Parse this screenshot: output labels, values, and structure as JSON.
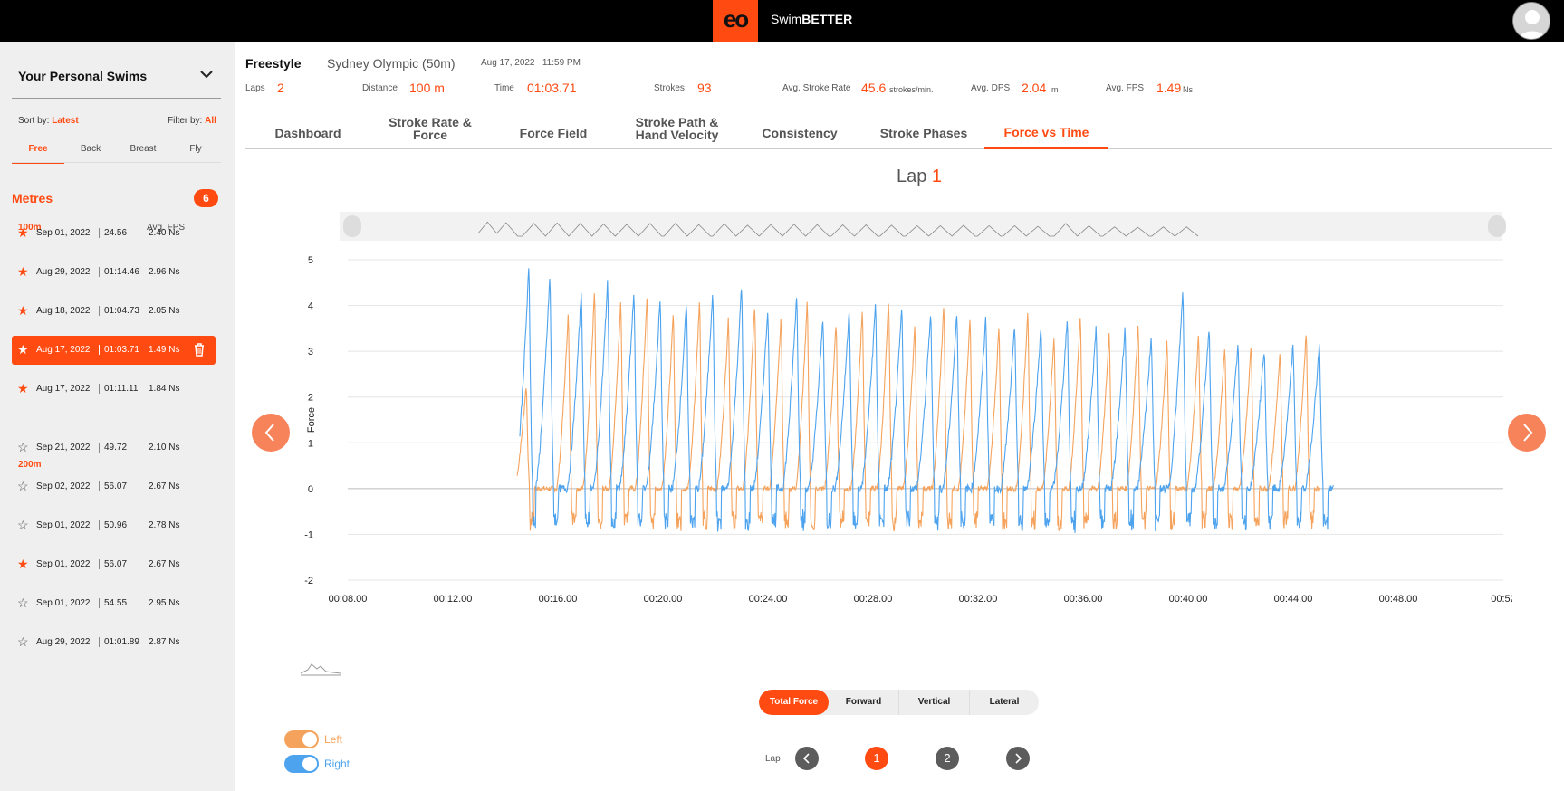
{
  "app": {
    "brand_prefix": "Swim",
    "brand_suffix": "BETTER",
    "logo_text": "eo"
  },
  "sidebar": {
    "title": "Your Personal Swims",
    "sort_label": "Sort by:",
    "sort_value": "Latest",
    "filter_label": "Filter by:",
    "filter_value": "All",
    "stroke_tabs": [
      "Free",
      "Back",
      "Breast",
      "Fly"
    ],
    "active_stroke": "Free",
    "section_title": "Metres",
    "section_count": "6",
    "fps_header": "Avg. FPS",
    "group_100": "100m",
    "group_200": "200m",
    "swims": [
      {
        "date": "Sep 01, 2022",
        "time": "24.56",
        "fps": "2.40 Ns",
        "starred": true
      },
      {
        "date": "Aug 29, 2022",
        "time": "01:14.46",
        "fps": "2.96 Ns",
        "starred": true
      },
      {
        "date": "Aug 18, 2022",
        "time": "01:04.73",
        "fps": "2.05 Ns",
        "starred": true
      },
      {
        "date": "Aug 17, 2022",
        "time": "01:03.71",
        "fps": "1.49 Ns",
        "starred": true,
        "selected": true
      },
      {
        "date": "Aug 17, 2022",
        "time": "01:11.11",
        "fps": "1.84 Ns",
        "starred": true
      },
      {
        "date": "Sep 21, 2022",
        "time": "49.72",
        "fps": "2.10 Ns",
        "starred": false
      },
      {
        "date": "Sep 02, 2022",
        "time": "56.07",
        "fps": "2.67 Ns",
        "starred": false
      },
      {
        "date": "Sep 01, 2022",
        "time": "50.96",
        "fps": "2.78 Ns",
        "starred": false
      },
      {
        "date": "Sep 01, 2022",
        "time": "56.07",
        "fps": "2.67 Ns",
        "starred": true
      },
      {
        "date": "Sep 01, 2022",
        "time": "54.55",
        "fps": "2.95 Ns",
        "starred": false
      },
      {
        "date": "Aug 29, 2022",
        "time": "01:01.89",
        "fps": "2.87 Ns",
        "starred": false
      }
    ]
  },
  "header": {
    "stroke": "Freestyle",
    "pool": "Sydney Olympic (50m)",
    "date": "Aug 17, 2022",
    "clock": "11:59 PM",
    "laps_label": "Laps",
    "laps_value": "2",
    "distance_label": "Distance",
    "distance_value": "100 m",
    "time_label": "Time",
    "time_value": "01:03.71",
    "strokes_label": "Strokes",
    "strokes_value": "93",
    "rate_label": "Avg. Stroke Rate",
    "rate_value": "45.6",
    "rate_unit": "strokes/min.",
    "dps_label": "Avg. DPS",
    "dps_value": "2.04",
    "dps_unit": "m",
    "fps_label": "Avg. FPS",
    "fps_value": "1.49",
    "fps_unit": "Ns"
  },
  "tabs": [
    {
      "line1": "Dashboard",
      "line2": ""
    },
    {
      "line1": "Stroke Rate &",
      "line2": "Force"
    },
    {
      "line1": "Force Field",
      "line2": ""
    },
    {
      "line1": "Stroke Path &",
      "line2": "Hand Velocity"
    },
    {
      "line1": "Consistency",
      "line2": ""
    },
    {
      "line1": "Stroke Phases",
      "line2": ""
    },
    {
      "line1": "Force vs Time",
      "line2": ""
    }
  ],
  "active_tab": "Force vs Time",
  "lap_title": {
    "label": "Lap",
    "value": "1"
  },
  "force_modes": [
    "Total Force",
    "Forward",
    "Vertical",
    "Lateral"
  ],
  "active_force_mode": "Total Force",
  "legend": {
    "left": "Left",
    "right": "Right"
  },
  "lap_pager": {
    "label": "Lap",
    "pages": [
      "1",
      "2"
    ],
    "active": "1"
  },
  "colors": {
    "accent": "#ff4b12",
    "left": "#f5a35c",
    "right": "#4da3ee"
  },
  "chart_data": {
    "type": "line",
    "ylabel": "Force",
    "xlabel": "",
    "ylim": [
      -2,
      5
    ],
    "xlim": [
      "00:08.00",
      "00:52.00"
    ],
    "x_ticks": [
      "00:08.00",
      "00:12.00",
      "00:16.00",
      "00:20.00",
      "00:24.00",
      "00:28.00",
      "00:32.00",
      "00:36.00",
      "00:40.00",
      "00:44.00",
      "00:48.00",
      "00:52"
    ],
    "y_ticks": [
      5,
      4,
      3,
      2,
      1,
      0,
      -1,
      -2
    ],
    "grid": true,
    "series": [
      {
        "name": "Left",
        "color": "#f5a35c",
        "stroke_peaks_t": [
          14.8,
          16.4,
          17.4,
          18.4,
          19.4,
          20.4,
          21.4,
          22.5,
          23.5,
          24.5,
          25.5,
          26.6,
          27.6,
          28.6,
          29.6,
          30.7,
          31.7,
          32.8,
          33.9,
          34.9,
          35.9,
          37.0,
          38.1,
          39.2,
          40.4,
          41.4,
          42.4,
          43.5,
          44.5
        ],
        "stroke_peaks_force": [
          2.3,
          3.9,
          4.4,
          4.2,
          4.3,
          3.9,
          4.2,
          3.8,
          4.1,
          3.8,
          4.2,
          3.7,
          4.0,
          4.2,
          3.6,
          4.1,
          3.8,
          3.6,
          4.0,
          3.4,
          3.9,
          3.5,
          3.7,
          3.3,
          3.4,
          3.2,
          3.2,
          3.0,
          3.5
        ],
        "baseline": 0.0
      },
      {
        "name": "Right",
        "color": "#4da3ee",
        "stroke_peaks_t": [
          14.9,
          15.7,
          16.9,
          17.9,
          18.9,
          19.9,
          20.9,
          21.9,
          23.0,
          24.0,
          25.1,
          26.1,
          27.1,
          28.1,
          29.1,
          30.2,
          31.2,
          32.3,
          33.4,
          34.4,
          35.4,
          36.5,
          37.6,
          38.6,
          39.8,
          40.8,
          41.9,
          42.9,
          44.0,
          45.0
        ],
        "stroke_peaks_force": [
          4.9,
          4.7,
          4.4,
          4.6,
          4.4,
          4.2,
          4.1,
          4.4,
          4.5,
          4.0,
          4.3,
          3.8,
          4.0,
          4.1,
          4.0,
          3.9,
          3.9,
          3.8,
          3.6,
          3.6,
          3.8,
          3.6,
          3.6,
          3.4,
          4.4,
          3.6,
          3.2,
          3.1,
          3.2,
          3.2
        ],
        "baseline": 0.0
      }
    ]
  }
}
